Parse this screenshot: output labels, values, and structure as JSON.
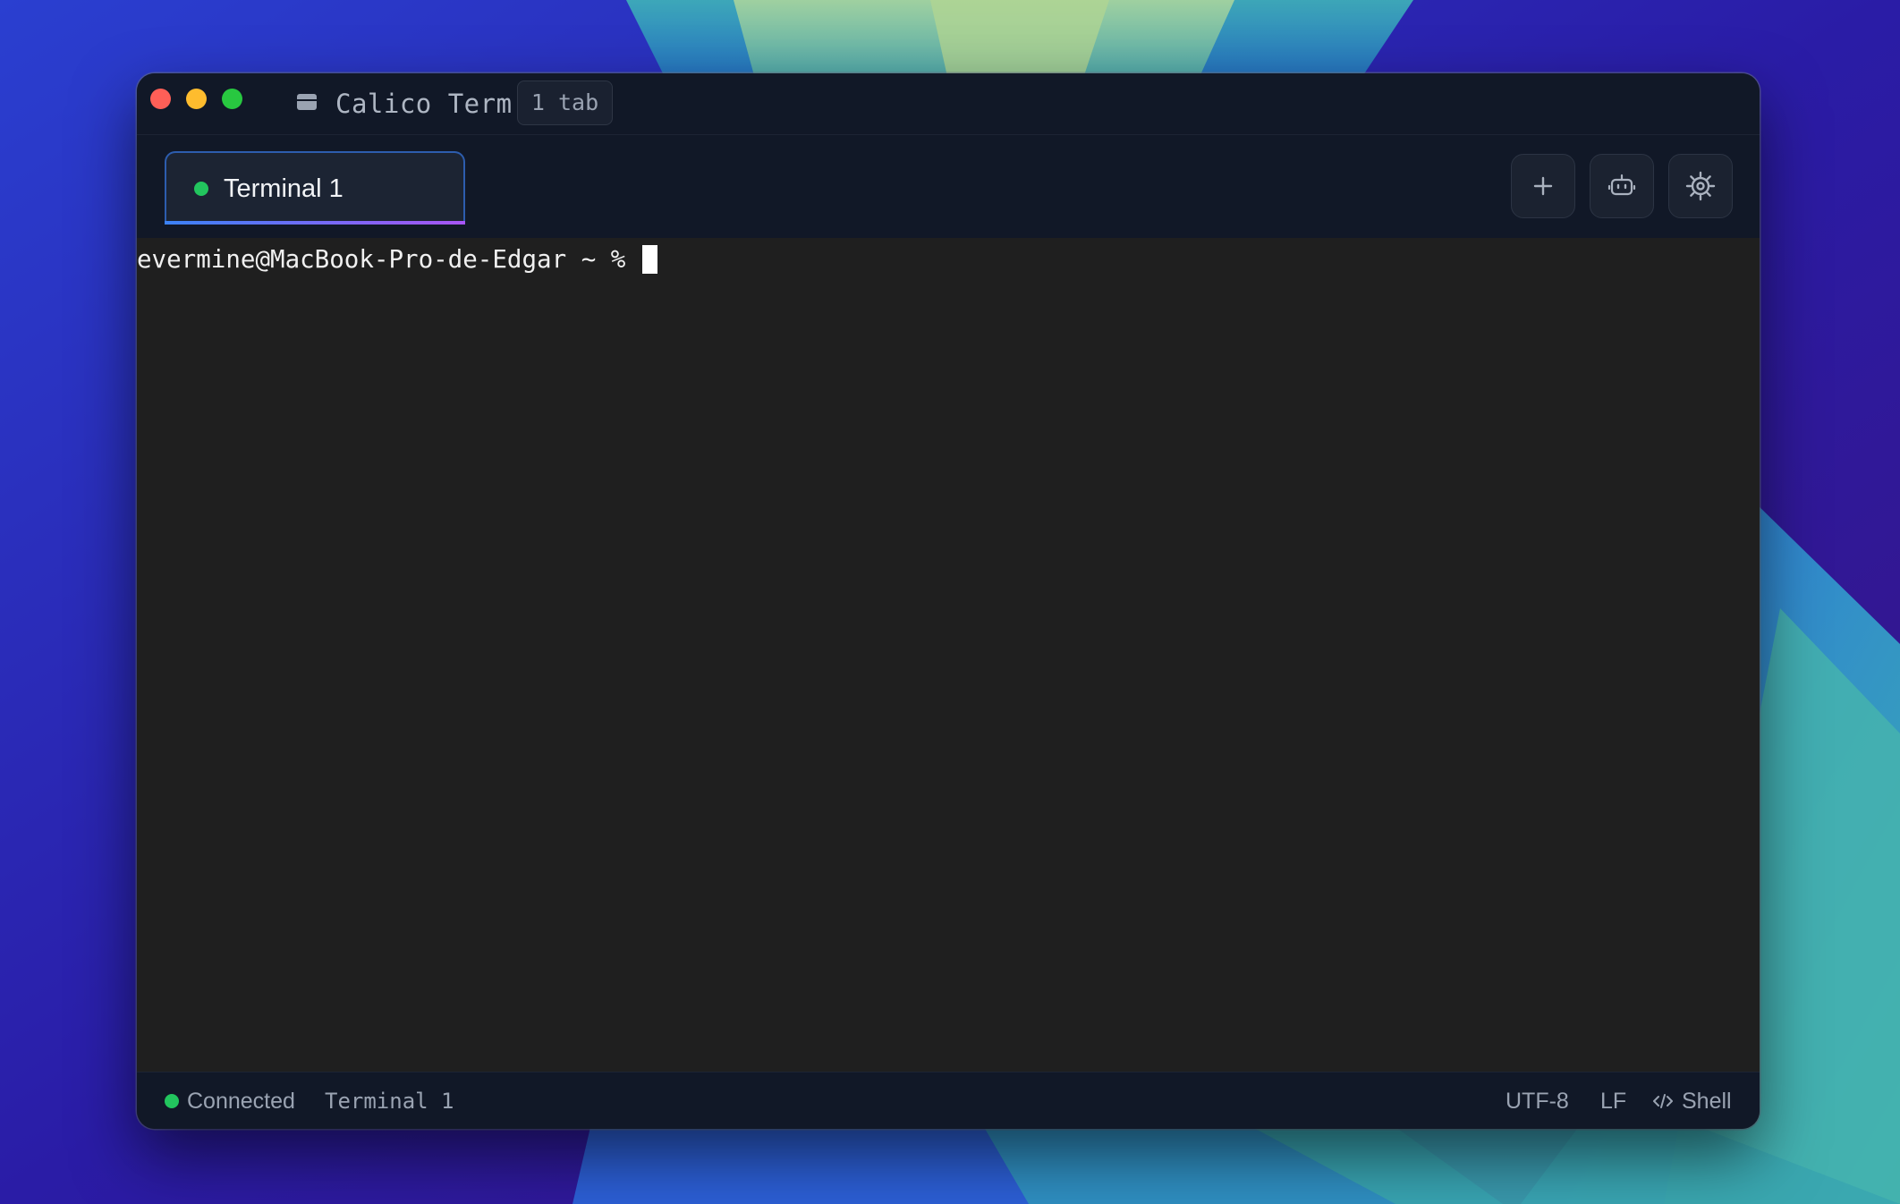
{
  "window": {
    "app_title": "Calico Term",
    "tab_count_badge": "1 tab",
    "app_icon": "terminal-window-icon"
  },
  "tabs": [
    {
      "label": "Terminal 1",
      "active": true,
      "status": "connected"
    }
  ],
  "toolbar": {
    "buttons": [
      {
        "name": "new-tab",
        "icon": "plus-icon"
      },
      {
        "name": "ai-assistant",
        "icon": "robot-icon"
      },
      {
        "name": "settings",
        "icon": "gear-icon"
      }
    ]
  },
  "terminal": {
    "prompt": "evermine@MacBook-Pro-de-Edgar ~ % "
  },
  "statusbar": {
    "connection": "Connected",
    "session": "Terminal 1",
    "encoding": "UTF-8",
    "line_ending": "LF",
    "language": "Shell",
    "language_icon": "code-icon"
  },
  "colors": {
    "accent_blue": "#3b82f6",
    "accent_purple": "#a855f7",
    "status_green": "#22c55e",
    "chrome_bg": "#111827",
    "terminal_bg": "#1f1f1f"
  }
}
